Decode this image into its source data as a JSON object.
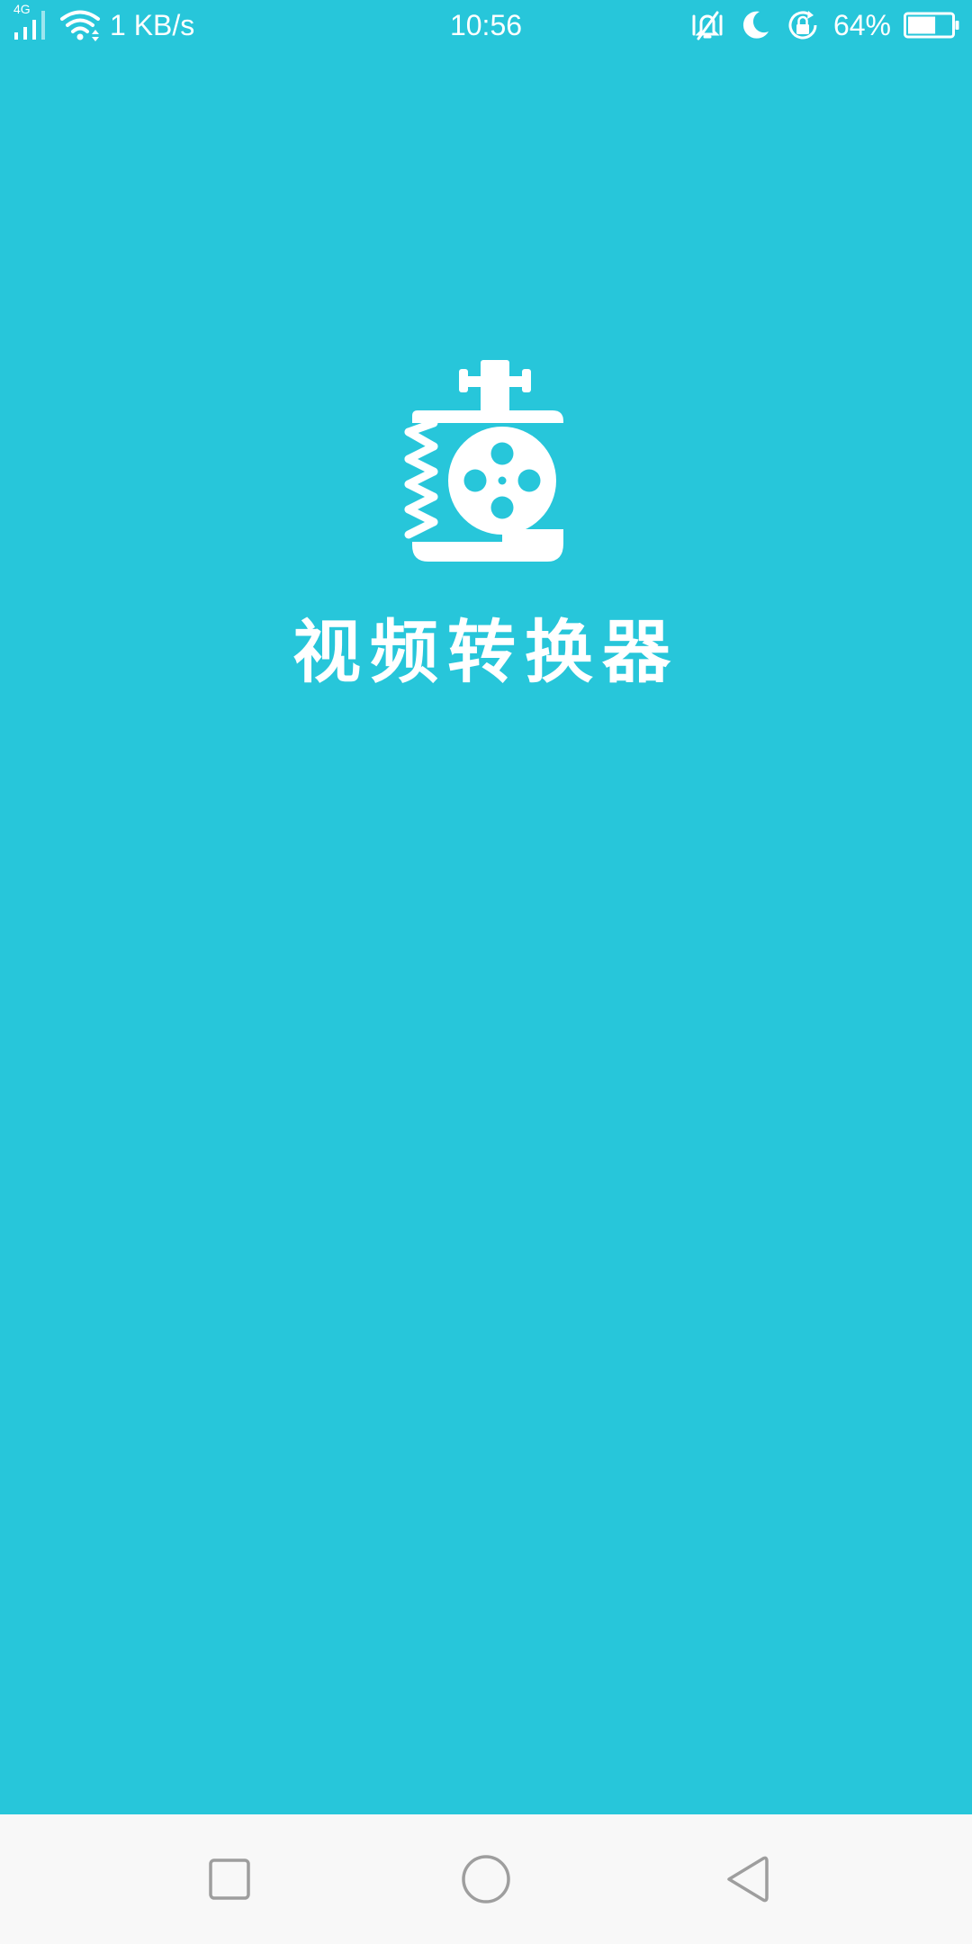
{
  "status_bar": {
    "network_type": "4G",
    "net_speed": "1 KB/s",
    "time": "10:56",
    "battery_percent": "64%",
    "battery_level": 0.64,
    "icons": [
      "signal-icon",
      "wifi-icon",
      "vibrate-icon",
      "moon-icon",
      "rotation-lock-icon",
      "battery-icon"
    ]
  },
  "splash": {
    "logo_icon": "film-reel-press-icon",
    "app_name": "视频转换器"
  },
  "nav_bar": {
    "buttons": [
      "recents-button",
      "home-button",
      "back-button"
    ]
  },
  "colors": {
    "background": "#27c6da",
    "nav_background": "#f8f8f8",
    "nav_icon": "#9e9e9e",
    "foreground": "#ffffff"
  }
}
